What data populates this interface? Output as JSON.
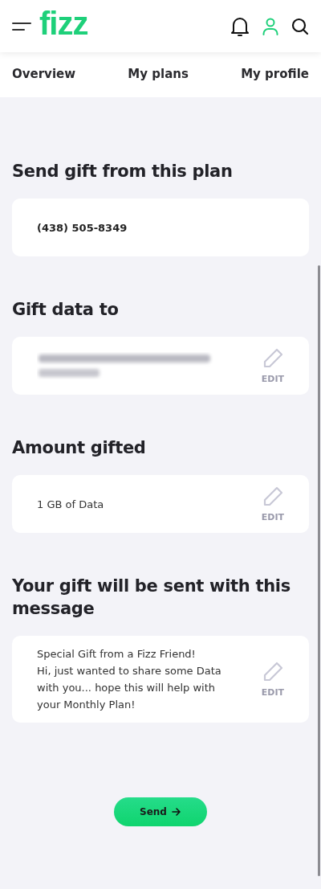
{
  "header": {
    "brand": "fizz"
  },
  "tabs": [
    {
      "label": "Overview",
      "selected": false
    },
    {
      "label": "My plans",
      "selected": false
    },
    {
      "label": "My profile",
      "selected": false
    }
  ],
  "sections": [
    {
      "title": "Send gift from this plan",
      "card": {
        "kind": "text",
        "lines": [
          "(438) 505-8349"
        ],
        "editable": false,
        "bold": true
      }
    },
    {
      "title": "Gift data to",
      "card": {
        "kind": "redacted",
        "editable": true,
        "edit_label": "EDIT"
      }
    },
    {
      "title": "Amount gifted",
      "card": {
        "kind": "text",
        "lines": [
          "1 GB of Data"
        ],
        "editable": true,
        "edit_label": "EDIT",
        "bold": false
      }
    },
    {
      "title": "Your gift will be sent with this message",
      "card": {
        "kind": "text",
        "lines": [
          "Special Gift from a Fizz Friend!",
          "Hi, just wanted to share some Data with you... hope this will help with your Monthly Plan!"
        ],
        "editable": true,
        "edit_label": "EDIT",
        "bold": false
      }
    }
  ],
  "send_button": {
    "label": "Send"
  }
}
